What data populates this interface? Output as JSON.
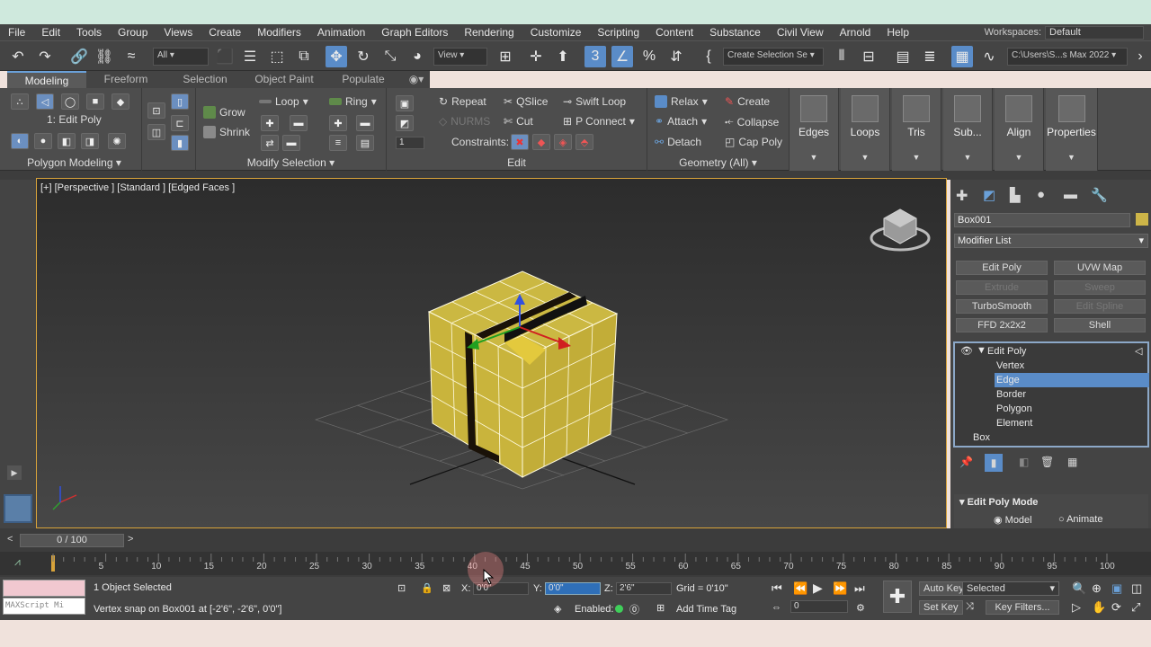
{
  "menu": {
    "items": [
      "File",
      "Edit",
      "Tools",
      "Group",
      "Views",
      "Create",
      "Modifiers",
      "Animation",
      "Graph Editors",
      "Rendering",
      "Customize",
      "Scripting",
      "Content",
      "Substance",
      "Civil View",
      "Arnold",
      "Help"
    ],
    "workspaces_label": "Workspaces:",
    "workspace_value": "Default"
  },
  "toolbar": {
    "selection_filter": "All",
    "view_dropdown": "View",
    "snap_number": "3",
    "create_selection_set": "Create Selection Se",
    "project_path": "C:\\Users\\S...s Max 2022"
  },
  "ribbon": {
    "tabs": [
      "Modeling",
      "Freeform",
      "Selection",
      "Object Paint",
      "Populate"
    ],
    "active_tab": "Modeling",
    "edit_poly_label": "1: Edit Poly",
    "panel_polygon_modeling": "Polygon Modeling ▾",
    "grow": "Grow",
    "shrink": "Shrink",
    "loop": "Loop",
    "ring": "Ring",
    "panel_modify_selection": "Modify Selection ▾",
    "repeat": "Repeat",
    "qslice": "QSlice",
    "swift_loop": "Swift Loop",
    "nurms": "NURMS",
    "cut": "Cut",
    "p_connect": "P Connect",
    "constraints": "Constraints:",
    "panel_edit": "Edit",
    "spinner_value": "1",
    "relax": "Relax",
    "create": "Create",
    "attach": "Attach",
    "collapse": "Collapse",
    "detach": "Detach",
    "cap_poly": "Cap Poly",
    "panel_geometry": "Geometry (All) ▾",
    "big_buttons": [
      "Edges",
      "Loops",
      "Tris",
      "Sub...",
      "Align",
      "Properties"
    ]
  },
  "viewport": {
    "label": "[+] [Perspective ] [Standard ] [Edged Faces ]"
  },
  "command_panel": {
    "object_name": "Box001",
    "modifier_list": "Modifier List",
    "mod_buttons": [
      {
        "label": "Edit Poly",
        "enabled": true
      },
      {
        "label": "UVW Map",
        "enabled": true
      },
      {
        "label": "Extrude",
        "enabled": false
      },
      {
        "label": "Sweep",
        "enabled": false
      },
      {
        "label": "TurboSmooth",
        "enabled": true
      },
      {
        "label": "Edit Spline",
        "enabled": false
      },
      {
        "label": "FFD 2x2x2",
        "enabled": true
      },
      {
        "label": "Shell",
        "enabled": true
      }
    ],
    "stack": {
      "edit_poly": "Edit Poly",
      "vertex": "Vertex",
      "edge": "Edge",
      "border": "Border",
      "polygon": "Polygon",
      "element": "Element",
      "box": "Box"
    },
    "rollout_title": "Edit Poly Mode",
    "model": "Model",
    "animate": "Animate"
  },
  "timeline": {
    "frame_readout": "0 / 100",
    "ticks": [
      "0",
      "5",
      "10",
      "15",
      "20",
      "25",
      "30",
      "35",
      "40",
      "45",
      "50",
      "55",
      "60",
      "65",
      "70",
      "75",
      "80",
      "85",
      "90",
      "95",
      "100"
    ]
  },
  "status": {
    "maxscript": "MAXScript Mi",
    "objects_selected": "1 Object Selected",
    "prompt": "Vertex snap on Box001 at [-2'6\", -2'6\", 0'0\"]",
    "x_label": "X:",
    "x_value": "0'0\"",
    "y_label": "Y:",
    "y_value": "0'0\"",
    "z_label": "Z:",
    "z_value": "2'6\"",
    "grid": "Grid = 0'10\"",
    "enabled": "Enabled:",
    "add_time_tag": "Add Time Tag",
    "auto_key": "Auto Key",
    "selected": "Selected",
    "set_key": "Set Key",
    "key_filters": "Key Filters...",
    "frame": "0"
  }
}
